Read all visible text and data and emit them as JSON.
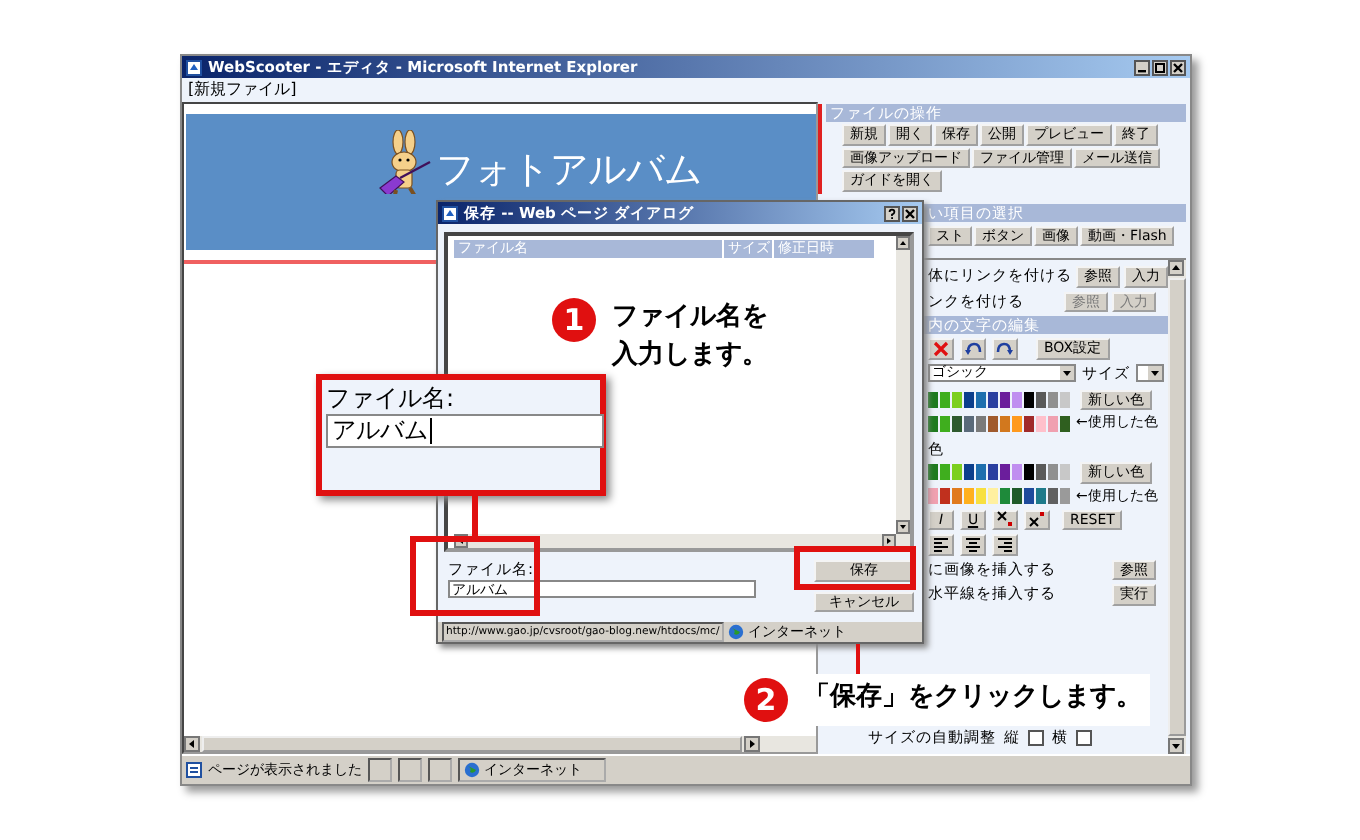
{
  "window": {
    "title": "WebScooter - エディタ - Microsoft Internet Explorer"
  },
  "file_label": "[新規ファイル]",
  "banner": {
    "title": "フォトアルバム"
  },
  "file_operations": {
    "header": "ファイルの操作",
    "button_rows": [
      {
        "buttons": [
          "新規",
          "開く",
          "保存",
          "公開",
          "プレビュー",
          "終了"
        ]
      },
      {
        "buttons": [
          "画像アップロード",
          "ファイル管理",
          "メール送信"
        ]
      },
      {
        "buttons": [
          "ガイドを開く"
        ]
      }
    ]
  },
  "item_select": {
    "header": "い項目の選択",
    "buttons": [
      "スト",
      "ボタン",
      "画像",
      "動画・Flash"
    ]
  },
  "links": [
    {
      "label": "体にリンクを付ける",
      "buttons": [
        {
          "label": "参照",
          "disabled": false
        },
        {
          "label": "入力",
          "disabled": false
        }
      ]
    },
    {
      "label": "ンクを付ける",
      "buttons": [
        {
          "label": "参照",
          "disabled": true
        },
        {
          "label": "入力",
          "disabled": true
        }
      ]
    }
  ],
  "text_edit": {
    "header": "内の文字の編集",
    "box_button": "BOX設定",
    "font": "ゴシック",
    "size_label": "サイズ",
    "palettes": [
      {
        "swatches": [
          {
            "color": "#1e7a1e"
          },
          {
            "color": "#3fae1e"
          },
          {
            "color": "#7ccf1e"
          },
          {
            "color": "#0c3f8c"
          },
          {
            "color": "#1e6fae"
          },
          {
            "color": "#2a3fa0"
          },
          {
            "color": "#6b1e9c"
          },
          {
            "color": "#c08ef0"
          },
          {
            "color": "#000000"
          },
          {
            "color": "#5a5a5a"
          },
          {
            "color": "#909090"
          },
          {
            "color": "#c8c8c8"
          }
        ],
        "new_button": "新しい色",
        "used": [
          {
            "color": "#1e7a1e"
          },
          {
            "color": "#3fae1e"
          },
          {
            "color": "#2e5a2e"
          },
          {
            "color": "#5a6a7a"
          },
          {
            "color": "#7a7a7a"
          },
          {
            "color": "#a05a2d"
          },
          {
            "color": "#d2781e"
          },
          {
            "color": "#ff9a1e"
          },
          {
            "color": "#a02a2a"
          },
          {
            "color": "#ffc0cb"
          },
          {
            "color": "#f0a0b0"
          },
          {
            "color": "#2f5f1f"
          }
        ],
        "used_label": "←使用した色"
      },
      {
        "label": "色",
        "swatches": [
          {
            "color": "#1e7a1e"
          },
          {
            "color": "#3fae1e"
          },
          {
            "color": "#7ccf1e"
          },
          {
            "color": "#0c3f8c"
          },
          {
            "color": "#1e6fae"
          },
          {
            "color": "#2a3fa0"
          },
          {
            "color": "#6b1e9c"
          },
          {
            "color": "#c08ef0"
          },
          {
            "color": "#000000"
          },
          {
            "color": "#5a5a5a"
          },
          {
            "color": "#909090"
          },
          {
            "color": "#c8c8c8"
          }
        ],
        "new_button": "新しい色",
        "used": [
          {
            "color": "#f0a0b0"
          },
          {
            "color": "#c0301e"
          },
          {
            "color": "#e07a1e"
          },
          {
            "color": "#ffb01e"
          },
          {
            "color": "#f8e040"
          },
          {
            "color": "#fff0a0"
          },
          {
            "color": "#1e8a3a"
          },
          {
            "color": "#1e5a2a"
          },
          {
            "color": "#1e4a9c"
          },
          {
            "color": "#1e7a8a"
          },
          {
            "color": "#606060"
          },
          {
            "color": "#9a9a9a"
          }
        ],
        "used_label": "←使用した色"
      }
    ],
    "format_buttons": [
      "I",
      "U"
    ],
    "reset_button": "RESET"
  },
  "inserts": [
    {
      "label": "に画像を挿入する",
      "button": "参照"
    },
    {
      "label": "水平線を挿入する",
      "button": "実行"
    }
  ],
  "auto_size": {
    "label": "サイズの自動調整",
    "options": [
      {
        "label": "縦",
        "checked": false
      },
      {
        "label": "横",
        "checked": false
      }
    ]
  },
  "status_bar": {
    "message": "ページが表示されました",
    "zone": "インターネット"
  },
  "dialog": {
    "title": "保存 -- Web ページ ダイアログ",
    "columns": [
      "ファイル名",
      "サイズ",
      "修正日時"
    ],
    "filename_label": "ファイル名:",
    "filename_value": "アルバム",
    "buttons": [
      "保存",
      "キャンセル"
    ],
    "status_url": "http://www.gao.jp/cvsroot/gao-blog.new/htdocs/mc/",
    "status_zone": "インターネット"
  },
  "zoom_box": {
    "label": "ファイル名:",
    "value": "アルバム"
  },
  "callouts": [
    {
      "number": "1",
      "lines": [
        "ファイル名を",
        "入力します。"
      ]
    },
    {
      "number": "2",
      "lines": [
        "「保存」をクリックします。"
      ]
    }
  ]
}
